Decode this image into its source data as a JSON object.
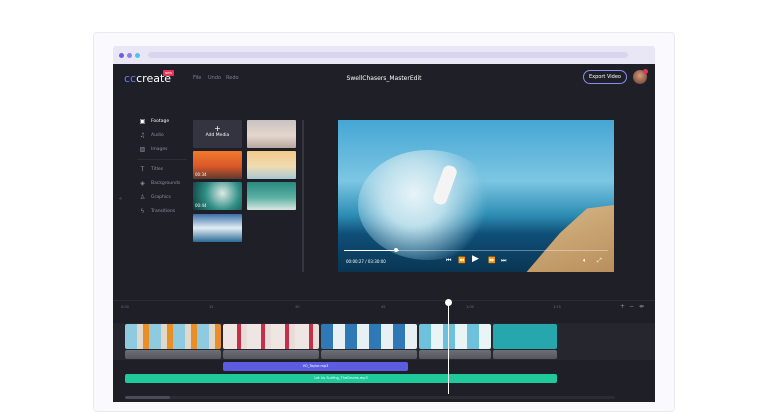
{
  "app": {
    "logo": "cccreate",
    "logo_badge": "NEW",
    "project_title": "SwellChasers_MasterEdit",
    "export_label": "Export Video"
  },
  "menu": [
    {
      "label": "File"
    },
    {
      "label": "Undo"
    },
    {
      "label": "Redo"
    }
  ],
  "sidebar": {
    "items": [
      {
        "label": "Footage",
        "icon": "film-icon"
      },
      {
        "label": "Audio",
        "icon": "music-icon"
      },
      {
        "label": "Images",
        "icon": "image-icon"
      },
      {
        "label": "Titles",
        "icon": "text-icon"
      },
      {
        "label": "Backgrounds",
        "icon": "layers-icon"
      },
      {
        "label": "Graphics",
        "icon": "badge-icon"
      },
      {
        "label": "Transitions",
        "icon": "bolt-icon"
      }
    ],
    "active": "Footage",
    "collapse": "«"
  },
  "media": {
    "add_label": "Add Media",
    "add_icon": "+",
    "durations": [
      "00:34",
      "00:44"
    ]
  },
  "player": {
    "time": "00:00:27 / 03:30:00",
    "progress": 0.21
  },
  "timeline": {
    "ticks": [
      "0:00",
      "15",
      "30",
      "45",
      "1:00",
      "1:15"
    ],
    "voice_clip": "VO_Taylor.mp3",
    "music_clip": "Let Us Surfing_TheDrums.mp3",
    "playhead_fraction": 0.61
  }
}
